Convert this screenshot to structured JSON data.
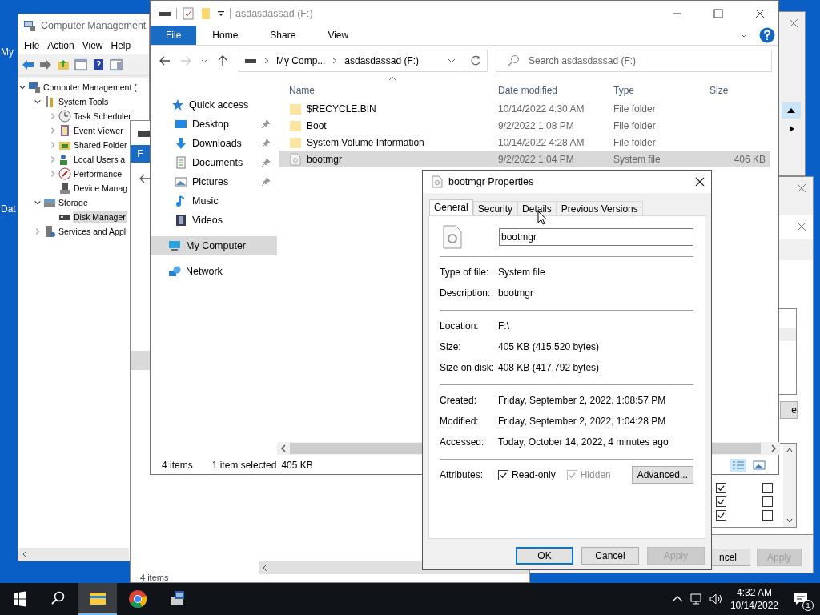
{
  "desktop_icons": [
    {
      "label": "My"
    },
    {
      "label": "Dat"
    }
  ],
  "computer_management": {
    "title": "Computer Management",
    "menu": [
      "File",
      "Action",
      "View",
      "Help"
    ],
    "tree": [
      {
        "label": "Computer Management (",
        "expanded": true,
        "selected": false,
        "children": [
          {
            "label": "System Tools",
            "expanded": true,
            "selected": false,
            "children": [
              {
                "label": "Task Scheduler",
                "expanded": false,
                "selected": false
              },
              {
                "label": "Event Viewer",
                "expanded": false,
                "selected": false
              },
              {
                "label": "Shared Folder",
                "expanded": false,
                "selected": false
              },
              {
                "label": "Local Users a",
                "expanded": false,
                "selected": false
              },
              {
                "label": "Performance",
                "expanded": false,
                "selected": false
              },
              {
                "label": "Device Manag",
                "selected": false
              }
            ]
          },
          {
            "label": "Storage",
            "expanded": true,
            "selected": false,
            "children": [
              {
                "label": "Disk Manager",
                "selected": true
              }
            ]
          },
          {
            "label": "Services and Appl",
            "expanded": false,
            "selected": false
          }
        ]
      }
    ]
  },
  "back_explorer": {
    "tab": "F",
    "status": "4 items"
  },
  "back_dialog": {
    "buttons": [
      {
        "label": "ncel",
        "disabled": false
      },
      {
        "label": "Apply",
        "disabled": true
      }
    ],
    "side_button": "e",
    "checkbox_rows": [
      {
        "first": true,
        "second": false
      },
      {
        "first": true,
        "second": false
      },
      {
        "first": true,
        "second": false
      }
    ]
  },
  "explorer": {
    "title": "asdasdassad (F:)",
    "ribbon_tabs": [
      {
        "label": "File",
        "selected": true
      },
      {
        "label": "Home",
        "selected": false
      },
      {
        "label": "Share",
        "selected": false
      },
      {
        "label": "View",
        "selected": false
      }
    ],
    "address": [
      "My Comp...",
      "asdasdassad (F:)"
    ],
    "search": {
      "placeholder": "Search asdasdassad (F:)"
    },
    "nav": [
      {
        "label": "Quick access",
        "selected": false,
        "children": [
          {
            "label": "Desktop",
            "pinned": true,
            "selected": false
          },
          {
            "label": "Downloads",
            "pinned": true,
            "selected": false
          },
          {
            "label": "Documents",
            "pinned": true,
            "selected": false
          },
          {
            "label": "Pictures",
            "pinned": true,
            "selected": false
          },
          {
            "label": "Music",
            "pinned": false,
            "selected": false
          },
          {
            "label": "Videos",
            "pinned": false,
            "selected": false
          }
        ]
      },
      {
        "label": "My Computer",
        "selected": true
      },
      {
        "label": "Network",
        "selected": false
      }
    ],
    "columns": [
      "Name",
      "Date modified",
      "Type",
      "Size"
    ],
    "rows": [
      {
        "kind": "folder",
        "name": "$RECYCLE.BIN",
        "date": "10/14/2022 4:30 AM",
        "type": "File folder",
        "selected": false
      },
      {
        "kind": "folder",
        "name": "Boot",
        "date": "9/2/2022 1:08 PM",
        "type": "File folder",
        "selected": false
      },
      {
        "kind": "folder",
        "name": "System Volume Information",
        "date": "10/14/2022 4:28 AM",
        "type": "File folder",
        "selected": false
      },
      {
        "kind": "file",
        "name": "bootmgr",
        "date": "9/2/2022 1:04 PM",
        "type": "System file",
        "size": "406 KB",
        "selected": true
      }
    ],
    "status": {
      "count": "4 items",
      "selection": "1 item selected",
      "size": "405 KB"
    }
  },
  "properties": {
    "title": "bootmgr Properties",
    "tabs": [
      {
        "label": "General",
        "selected": true
      },
      {
        "label": "Security",
        "selected": false
      },
      {
        "label": "Details",
        "selected": false
      },
      {
        "label": "Previous Versions",
        "selected": false
      }
    ],
    "file_name": "bootmgr",
    "groups": [
      [
        {
          "label": "Type of file:",
          "value": "System file"
        },
        {
          "label": "Description:",
          "value": "bootmgr"
        }
      ],
      [
        {
          "label": "Location:",
          "value": "F:\\"
        },
        {
          "label": "Size:",
          "value": "405 KB (415,520 bytes)"
        },
        {
          "label": "Size on disk:",
          "value": "408 KB (417,792 bytes)"
        }
      ],
      [
        {
          "label": "Created:",
          "value": "Friday, September 2, 2022, 1:08:57 PM"
        },
        {
          "label": "Modified:",
          "value": "Friday, September 2, 2022, 1:04:28 PM"
        },
        {
          "label": "Accessed:",
          "value": "Today, October 14, 2022, 4 minutes ago"
        }
      ]
    ],
    "attributes": {
      "label": "Attributes:",
      "items": [
        {
          "label": "Read-only",
          "checked": true,
          "disabled": false
        },
        {
          "label": "Hidden",
          "checked": true,
          "disabled": true
        }
      ],
      "advanced": "Advanced..."
    },
    "buttons": [
      {
        "label": "OK",
        "default": true,
        "disabled": false
      },
      {
        "label": "Cancel",
        "default": false,
        "disabled": false
      },
      {
        "label": "Apply",
        "default": false,
        "disabled": true
      }
    ]
  },
  "taskbar": {
    "apps": [
      {
        "selected": true
      },
      {
        "selected": false
      },
      {
        "selected": false
      }
    ],
    "time": "4:32 AM",
    "date": "10/14/2022",
    "notifications": "1"
  }
}
